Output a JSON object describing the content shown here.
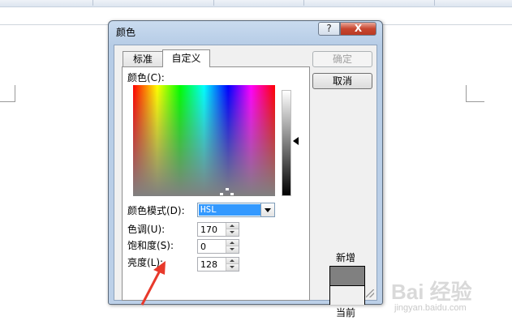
{
  "dialog": {
    "title": "颜色",
    "help_label": "?",
    "close_label": "X"
  },
  "tabs": [
    {
      "label": "标准",
      "active": false
    },
    {
      "label": "自定义",
      "active": true
    }
  ],
  "custom": {
    "colors_label": "颜色(C):",
    "color_model_label": "颜色模式(D):",
    "color_model_value": "HSL",
    "hue_label": "色调(U):",
    "hue_value": "170",
    "sat_label": "饱和度(S):",
    "sat_value": "0",
    "lum_label": "亮度(L):",
    "lum_value": "128"
  },
  "buttons": {
    "ok_label": "确定",
    "ok_enabled": false,
    "cancel_label": "取消"
  },
  "preview": {
    "new_label": "新增",
    "current_label": "当前",
    "new_color": "#808080",
    "current_color": "#f0f0f0"
  },
  "annotation": {
    "arrow_color": "#e8392b"
  },
  "watermark": {
    "logo": "Bai 经验",
    "url": "jingyan.baidu.com"
  }
}
